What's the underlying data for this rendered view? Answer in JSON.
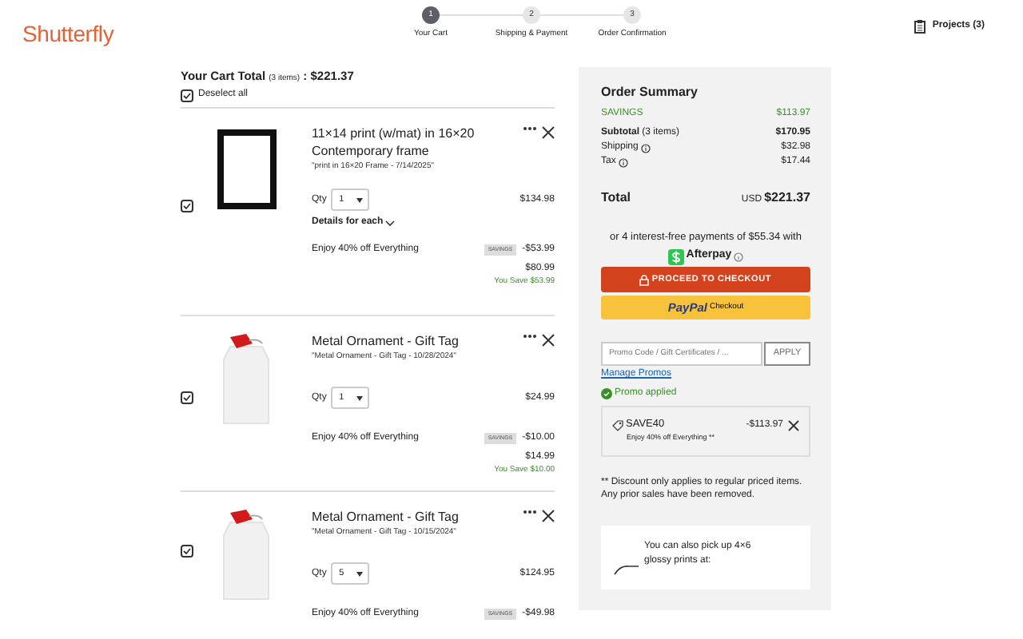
{
  "header": {
    "logo": "Shutterfly",
    "steps": [
      {
        "number": "1",
        "label": "Your Cart",
        "selected": true
      },
      {
        "number": "2",
        "label": "Shipping & Payment",
        "selected": false
      },
      {
        "number": "3",
        "label": "Order Confirmation",
        "selected": false
      }
    ],
    "projects": "Projects (3)"
  },
  "cart": {
    "title": "Your Cart Total",
    "count": "(3 items)",
    "total": ": $221.37",
    "deselect": {
      "label": "Deselect all",
      "checked": true
    }
  },
  "items": [
    {
      "kind": "frame",
      "checked": true,
      "title": "11×14 print (w/mat) in 16×20",
      "subtitle": "Contemporary frame",
      "note": "\"print in 16×20 Frame - 7/14/2025\"",
      "qty_label": "Qty",
      "qty": "1",
      "price": "$134.98",
      "details": "Details for each",
      "promo": "Enjoy 40% off Everything",
      "savings_badge": "SAVINGS",
      "discount": "-$53.99",
      "final": "$80.99",
      "you_save": "You Save $53.99"
    },
    {
      "kind": "ornament",
      "checked": true,
      "title": "Metal Ornament - Gift Tag",
      "note": "\"Metal Ornament - Gift Tag - 10/28/2024\"",
      "qty_label": "Qty",
      "qty": "1",
      "price": "$24.99",
      "promo": "Enjoy 40% off Everything",
      "savings_badge": "SAVINGS",
      "discount": "-$10.00",
      "final": "$14.99",
      "you_save": "You Save $10.00"
    },
    {
      "kind": "ornament",
      "checked": true,
      "title": "Metal Ornament - Gift Tag",
      "note": "\"Metal Ornament - Gift Tag - 10/15/2024\"",
      "qty_label": "Qty",
      "qty": "5",
      "price": "$124.95",
      "promo": "Enjoy 40% off Everything",
      "savings_badge": "SAVINGS",
      "discount": "-$49.98"
    }
  ],
  "summary": {
    "title": "Order Summary",
    "savings_label": "SAVINGS",
    "savings_value": "$113.97",
    "rows": [
      {
        "label": "**Subtotal** (3 items)",
        "value": "$170.95",
        "info": false,
        "bold": true
      },
      {
        "label": "Shipping",
        "value": "$32.98",
        "info": true,
        "bold": false
      },
      {
        "label": "Tax",
        "value": "$17.44",
        "info": true,
        "bold": false
      }
    ],
    "total_label": "Total",
    "currency": "USD",
    "total": "$221.37",
    "afterpay_text": "or 4 interest-free payments of $55.34 with",
    "afterpay": "Afterpay",
    "checkout": "PROCEED TO CHECKOUT",
    "paypal": "PayPal",
    "paypal_checkout": "Checkout",
    "promo_placeholder": "Promo Code / Gift Certificates / ...",
    "apply": "APPLY",
    "manage": "Manage Promos",
    "promo_status": "Promo applied",
    "promo_code": "SAVE40",
    "promo_amount": "-$113.97",
    "promo_desc": "Enjoy 40% off Everything **",
    "disclaimer": "** Discount only applies to regular priced items. Any prior sales have been removed.",
    "pickup": "You can also pick up 4×6 glossy prints at:"
  }
}
